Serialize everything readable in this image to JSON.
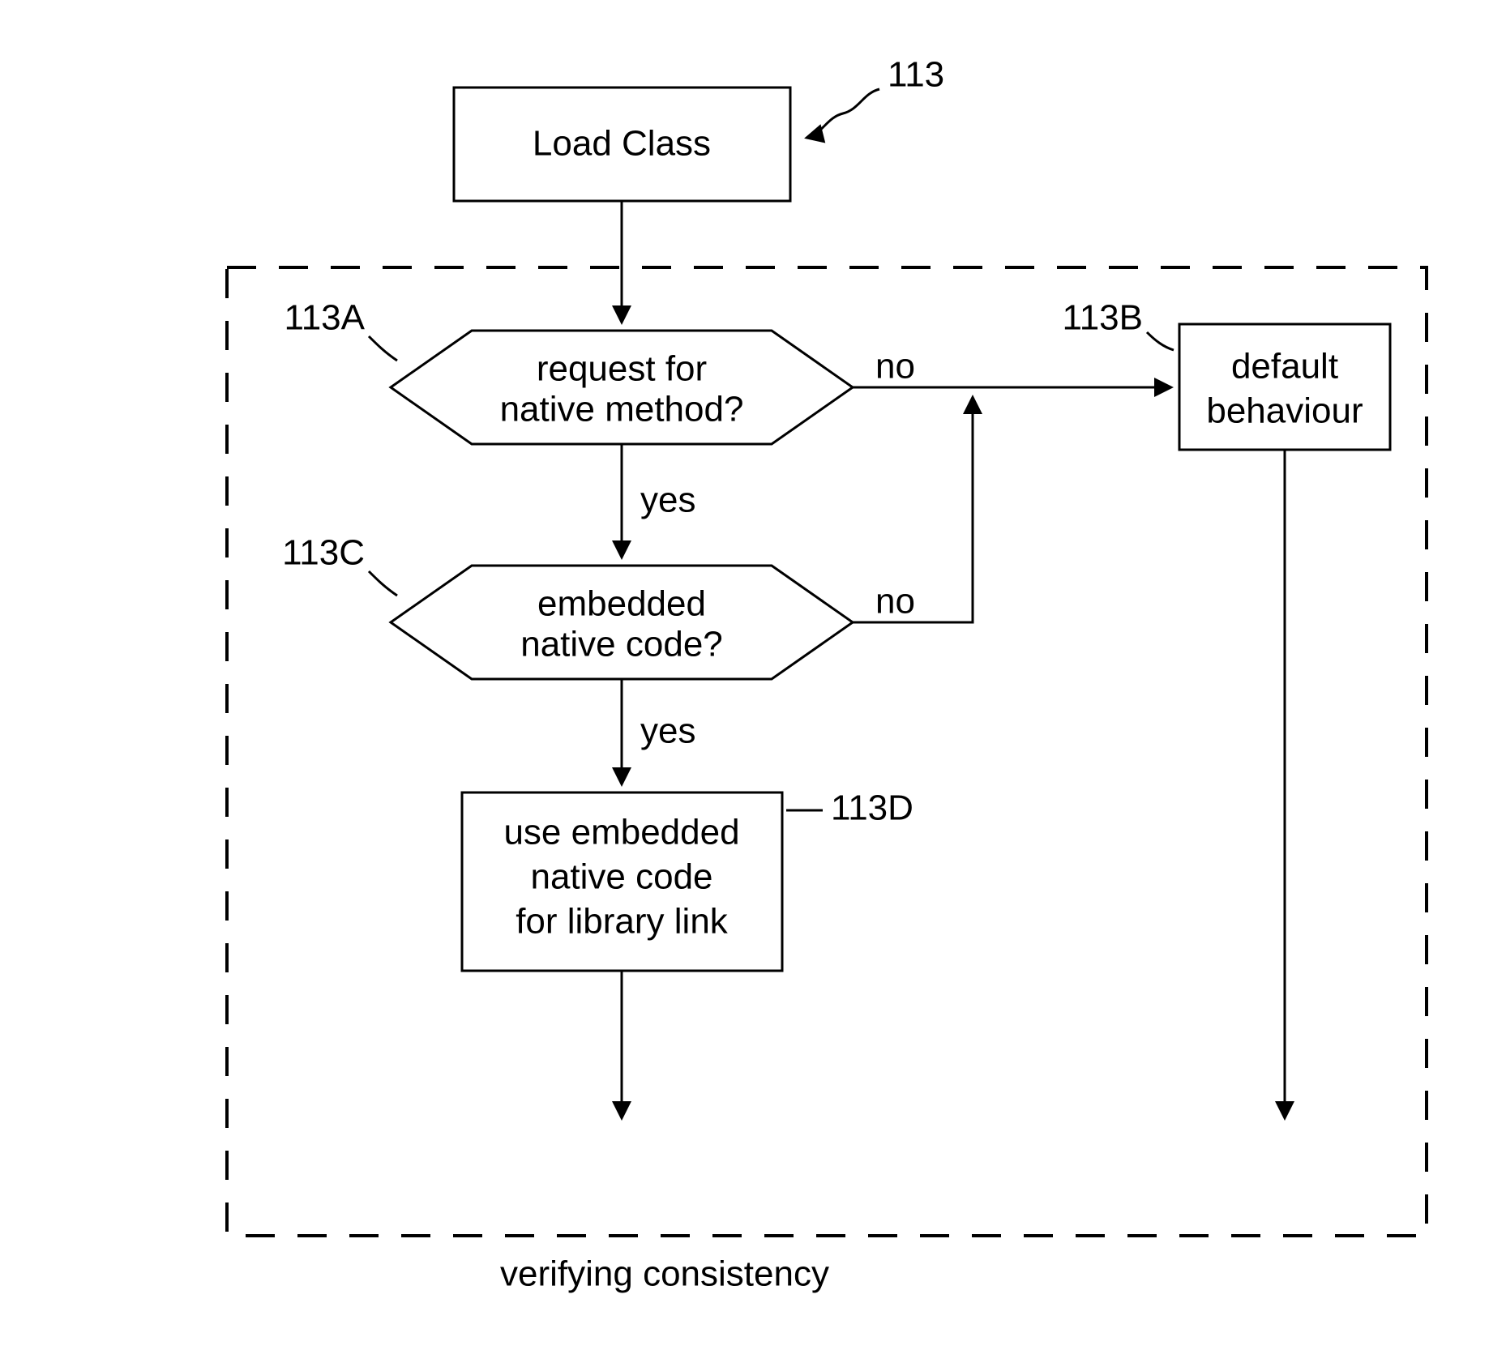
{
  "chart_data": {
    "type": "flowchart",
    "title": "",
    "nodes": [
      {
        "id": "load",
        "kind": "process",
        "label": "Load Class",
        "ref": "113"
      },
      {
        "id": "d1",
        "kind": "decision",
        "label": "request for native method?",
        "ref": "113A"
      },
      {
        "id": "d2",
        "kind": "decision",
        "label": "embedded native code?",
        "ref": "113C"
      },
      {
        "id": "use",
        "kind": "process",
        "label": "use embedded native code for library link",
        "ref": "113D"
      },
      {
        "id": "def",
        "kind": "process",
        "label": "default behaviour",
        "ref": "113B"
      }
    ],
    "edges": [
      {
        "from": "load",
        "to": "d1",
        "label": ""
      },
      {
        "from": "d1",
        "to": "d2",
        "label": "yes"
      },
      {
        "from": "d1",
        "to": "def",
        "label": "no"
      },
      {
        "from": "d2",
        "to": "use",
        "label": "yes"
      },
      {
        "from": "d2",
        "to": "def",
        "label": "no"
      },
      {
        "from": "use",
        "to": "exit_left",
        "label": ""
      },
      {
        "from": "def",
        "to": "exit_right",
        "label": ""
      }
    ],
    "group": {
      "label": "verifying consistency",
      "members": [
        "d1",
        "d2",
        "use",
        "def"
      ]
    }
  },
  "labels": {
    "load": "Load Class",
    "d1_l1": "request for",
    "d1_l2": "native method?",
    "d2_l1": "embedded",
    "d2_l2": "native code?",
    "use_l1": "use embedded",
    "use_l2": "native code",
    "use_l3": "for library link",
    "def_l1": "default",
    "def_l2": "behaviour",
    "yes": "yes",
    "no": "no",
    "group": "verifying consistency"
  },
  "refs": {
    "main": "113",
    "d1": "113A",
    "def": "113B",
    "d2": "113C",
    "use": "113D"
  }
}
